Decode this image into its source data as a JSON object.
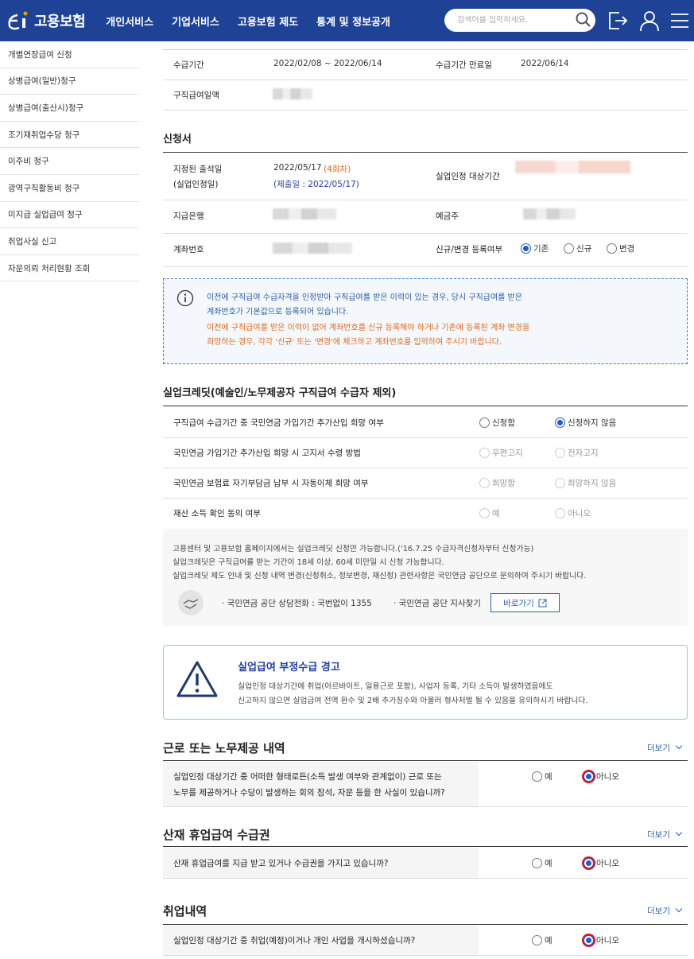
{
  "header": {
    "logo_text": "고용보험",
    "nav": [
      "개인서비스",
      "기업서비스",
      "고용보험 제도",
      "통계 및 정보공개"
    ],
    "search_placeholder": "검색어를 입력하세요.",
    "colors": {
      "brand": "#1e4396"
    },
    "icons": [
      "search-icon",
      "logout-icon",
      "user-icon",
      "menu-icon"
    ]
  },
  "sidebar": {
    "items": [
      "개별연장급여 신청",
      "상병급여(일반)청구",
      "상병급여(출산시)청구",
      "조기재취업수당 청구",
      "이주비 청구",
      "광역구직활동비 청구",
      "미지급 실업급여 청구",
      "취업사실 신고",
      "자문의뢰 처리현황 조회"
    ]
  },
  "summary": {
    "period_label": "수급기간",
    "period_value": "2022/02/08 ~ 2022/06/14",
    "end_label": "수급기간 만료일",
    "end_value": "2022/06/14",
    "daily_label": "구직급여일액"
  },
  "application": {
    "title": "신청서",
    "attend_label_1": "지정된 출석일",
    "attend_label_2": "(실업인정일)",
    "attend_date": "2022/05/17",
    "attend_count": "(4회차)",
    "submit_date": "(제출일 : 2022/05/17)",
    "period_label": "실업인정 대상기간",
    "bank_label": "지급은행",
    "holder_label": "예금주",
    "account_label": "계좌번호",
    "reg_label": "신규/변경 등록여부",
    "reg_options": [
      "기존",
      "신규",
      "변경"
    ],
    "reg_selected": "기존"
  },
  "info": {
    "blue_line1": "이전에 구직급여 수급자격을 인정받아 구직급여를 받은 이력이 있는 경우, 당시 구직급여를 받은",
    "blue_line2": "계좌번호가 기본값으로 등록되어 있습니다.",
    "orange_line1": "이전에 구직급여를 받은 이력이 없어 계좌번호를 신규 등록해야 하거나 기존에 등록된 계좌 변경을",
    "orange_line2": "희망하는 경우, 각각 '신규' 또는 '변경'에 체크하고 계좌번호를 입력하여 주시기 바랍니다."
  },
  "credit": {
    "title": "실업크레딧(예술인/노무제공자 구직급여 수급자 제외)",
    "q1": "구직급여 수급기간 중 국민연금 가입기간 추가산입 희망 여부",
    "q1_options": [
      "신청함",
      "신청하지 않음"
    ],
    "q2": "국민연금 가입기간 추가산입 희망 시 고지서 수령 방법",
    "q2_options": [
      "우편고지",
      "전자고지"
    ],
    "q3": "국민연금 보험료 자기부담금 납부 시 자동이체 희망 여부",
    "q3_options": [
      "희망함",
      "희망하지 않음"
    ],
    "q4": "재산 소득 확인 동의 여부",
    "q4_options": [
      "예",
      "아니오"
    ],
    "notice1": "고용센터 및 고용보험 홈페이지에서는 실업크레딧 신청만 가능합니다.('16.7.25 수급자격신청자부터 신청가능)",
    "notice2": "실업크레딧은 구직급여를 받는 기간이 18세 이상, 60세 미만일 시 신청 가능합니다.",
    "notice3": "실업크레딧 제도 안내 및 신청 내역 변경(신청취소, 정보변경, 재신청) 관련사항은 국민연금 공단으로 문의하여 주시기 바랍니다.",
    "phone": "· 국민연금 공단 상담전화 : 국번없이 1355",
    "branch": "· 국민연금 공단 지사찾기",
    "go_button": "바로가기"
  },
  "warning": {
    "title": "실업급여 부정수급 경고",
    "line1": "실업인정 대상기간에 취업(아르바이트, 일용근로 포함), 사업자 등록, 기타 소득이 발생하였음에도",
    "line2": "신고하지 않으면 실업급여 전액 환수 및 2배 추가징수와 아울러 형사처벌 될 수 있음을 유의하시기 바랍니다."
  },
  "work": {
    "title": "근로 또는 노무제공 내역",
    "more": "더보기",
    "q1": "실업인정 대상기간 중 어떠한 형태로든(소득 발생 여부와 관계없이) 근로 또는",
    "q2": "노무를 제공하거나 수당이 발생하는 회의 참석, 자문 등을 한 사실이 있습니까?",
    "options": [
      "예",
      "아니오"
    ]
  },
  "injury": {
    "title": "산재 휴업급여 수급권",
    "more": "더보기",
    "q": "산재 휴업급여를 지급 받고 있거나 수급권을 가지고 있습니까?",
    "options": [
      "예",
      "아니오"
    ]
  },
  "job": {
    "title": "취업내역",
    "more": "더보기",
    "q": "실업인정 대상기간 중 취업(예정)이거나 개인 사업을 개시하셨습니까?",
    "options": [
      "예",
      "아니오"
    ]
  }
}
